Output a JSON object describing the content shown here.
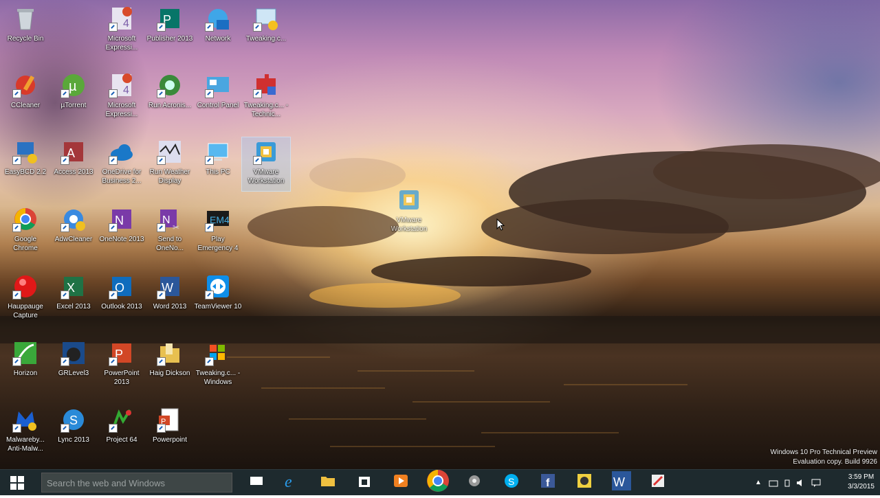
{
  "desktop": {
    "icons": [
      {
        "label": "Recycle Bin",
        "icon": "recycle-bin-icon"
      },
      {
        "label": "Microsoft Expressi...",
        "icon": "expression-icon"
      },
      {
        "label": "Publisher 2013",
        "icon": "publisher-icon"
      },
      {
        "label": "Network",
        "icon": "network-icon"
      },
      {
        "label": "Tweaking.c...",
        "icon": "tweaking-icon"
      },
      {
        "label": "CCleaner",
        "icon": "ccleaner-icon"
      },
      {
        "label": "µTorrent",
        "icon": "utorrent-icon"
      },
      {
        "label": "Microsoft Expressi...",
        "icon": "expression-icon"
      },
      {
        "label": "Run Acronis...",
        "icon": "acronis-icon"
      },
      {
        "label": "Control Panel",
        "icon": "control-panel-icon"
      },
      {
        "label": "Tweaking.c... - Technic...",
        "icon": "tweaking-tech-icon"
      },
      {
        "label": "EasyBCD 2.2",
        "icon": "easybcd-icon"
      },
      {
        "label": "Access 2013",
        "icon": "access-icon"
      },
      {
        "label": "OneDrive for Business 2...",
        "icon": "onedrive-icon"
      },
      {
        "label": "Run Weather Display",
        "icon": "weather-icon"
      },
      {
        "label": "This PC",
        "icon": "this-pc-icon"
      },
      {
        "label": "VMware Workstation",
        "icon": "vmware-icon",
        "selected": true
      },
      {
        "label": "Google Chrome",
        "icon": "chrome-icon"
      },
      {
        "label": "AdwCleaner",
        "icon": "adwcleaner-icon"
      },
      {
        "label": "OneNote 2013",
        "icon": "onenote-icon"
      },
      {
        "label": "Send to OneNo...",
        "icon": "send-onenote-icon"
      },
      {
        "label": "Play Emergency 4",
        "icon": "emergency-icon"
      },
      {
        "label": "Hauppauge Capture",
        "icon": "hauppauge-icon"
      },
      {
        "label": "Excel 2013",
        "icon": "excel-icon"
      },
      {
        "label": "Outlook 2013",
        "icon": "outlook-icon"
      },
      {
        "label": "Word 2013",
        "icon": "word-icon"
      },
      {
        "label": "TeamViewer 10",
        "icon": "teamviewer-icon"
      },
      {
        "label": "Horizon",
        "icon": "horizon-icon"
      },
      {
        "label": "GRLevel3",
        "icon": "grlevel-icon"
      },
      {
        "label": "PowerPoint 2013",
        "icon": "powerpoint-icon"
      },
      {
        "label": "Haig Dickson",
        "icon": "folder-icon"
      },
      {
        "label": "Tweaking.c... - Windows",
        "icon": "tweaking-win-icon"
      },
      {
        "label": "Malwareby... Anti-Malw...",
        "icon": "malwarebytes-icon"
      },
      {
        "label": "Lync 2013",
        "icon": "lync-icon"
      },
      {
        "label": "Project 64",
        "icon": "project64-icon"
      },
      {
        "label": "Powerpoint",
        "icon": "pptx-file-icon"
      }
    ],
    "dragging": {
      "label": "VMware Workstation",
      "icon": "vmware-icon"
    },
    "watermark": {
      "line1": "Windows 10 Pro Technical Preview",
      "line2": "Evaluation copy. Build 9926"
    }
  },
  "taskbar": {
    "search_placeholder": "Search the web and Windows",
    "apps": [
      {
        "name": "task-view",
        "icon": "task-view-icon"
      },
      {
        "name": "internet-explorer",
        "icon": "ie-icon"
      },
      {
        "name": "file-explorer",
        "icon": "file-explorer-icon"
      },
      {
        "name": "store",
        "icon": "store-icon"
      },
      {
        "name": "media-player",
        "icon": "media-icon"
      },
      {
        "name": "chrome",
        "icon": "chrome-icon"
      },
      {
        "name": "snipping",
        "icon": "tool-icon"
      },
      {
        "name": "skype",
        "icon": "skype-icon"
      },
      {
        "name": "facebook",
        "icon": "facebook-icon"
      },
      {
        "name": "app-yellow",
        "icon": "yellow-app-icon"
      },
      {
        "name": "word",
        "icon": "word-icon"
      },
      {
        "name": "paint",
        "icon": "paint-icon"
      }
    ],
    "clock": {
      "time": "3:59 PM",
      "date": "3/3/2015"
    }
  }
}
